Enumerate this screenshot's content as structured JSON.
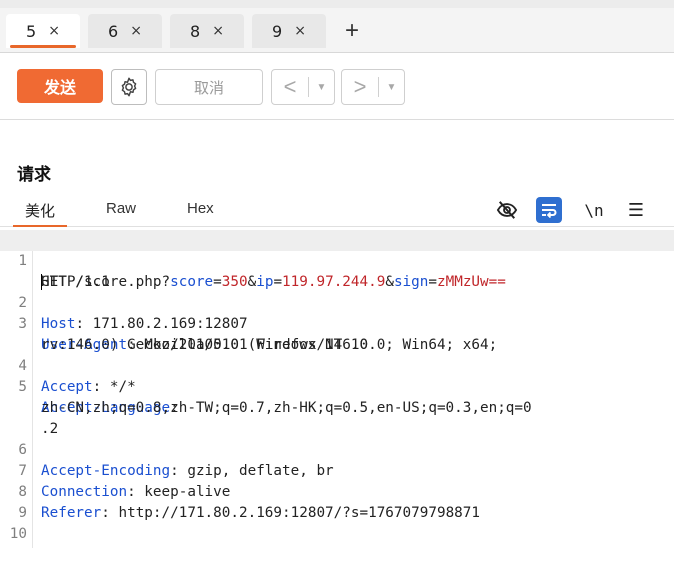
{
  "tabs": [
    {
      "label": "5",
      "close": "×"
    },
    {
      "label": "6",
      "close": "×"
    },
    {
      "label": "8",
      "close": "×"
    },
    {
      "label": "9",
      "close": "×"
    }
  ],
  "add_tab": "+",
  "toolbar": {
    "send_label": "发送",
    "cancel_label": "取消",
    "prev_arrow": "<",
    "next_arrow": ">",
    "dropdown": "▼"
  },
  "request": {
    "title": "请求",
    "subtabs": [
      "美化",
      "Raw",
      "Hex"
    ],
    "newline_toggle": "\\n",
    "menu_icon": "☰",
    "lines": {
      "n1": "1",
      "n2": "2",
      "n3": "3",
      "n4": "4",
      "n5": "5",
      "n6": "6",
      "n7": "7",
      "n8": "8",
      "n9": "9",
      "n10": "10",
      "l1_method": "GET /score.php?",
      "l1_k1": "score",
      "l1_e1": "=",
      "l1_v1": "350",
      "l1_a1": "&",
      "l1_k2": "ip",
      "l1_e2": "=",
      "l1_v2": "119.97.244.9",
      "l1_a2": "&",
      "l1_k3": "sign",
      "l1_e3": "=",
      "l1_v3": "zMMzUw==",
      "l1_cont": "HTTP/1.1",
      "l2_key": "Host",
      "l2_val": ": 171.80.2.169:12807",
      "l3_key": "User-Agent",
      "l3_val": ": Mozilla/5.0 (Windows NT 10.0; Win64; x64;",
      "l3_cont": "rv:146.0) Gecko/20100101 Firefox/146.0",
      "l4_key": "Accept",
      "l4_val": ": */*",
      "l5_key": "Accept-Language",
      "l5_val": ":",
      "l5_cont1": "zh-CN,zh;q=0.8,zh-TW;q=0.7,zh-HK;q=0.5,en-US;q=0.3,en;q=0",
      "l5_cont2": ".2",
      "l6_key": "Accept-Encoding",
      "l6_val": ": gzip, deflate, br",
      "l7_key": "Connection",
      "l7_val": ": keep-alive",
      "l8_key": "Referer",
      "l8_val": ": http://171.80.2.169:12807/?s=1767079798871"
    }
  },
  "colors": {
    "accent": "#f06a33",
    "key": "#1a4fd0",
    "value": "#c0262a",
    "wrap_button": "#2f6fd0"
  },
  "icons": [
    "close-icon",
    "plus-icon",
    "gear-icon",
    "chevron-left-icon",
    "chevron-right-icon",
    "dropdown-icon",
    "eye-off-icon",
    "wrap-icon",
    "newline-icon",
    "menu-icon"
  ]
}
